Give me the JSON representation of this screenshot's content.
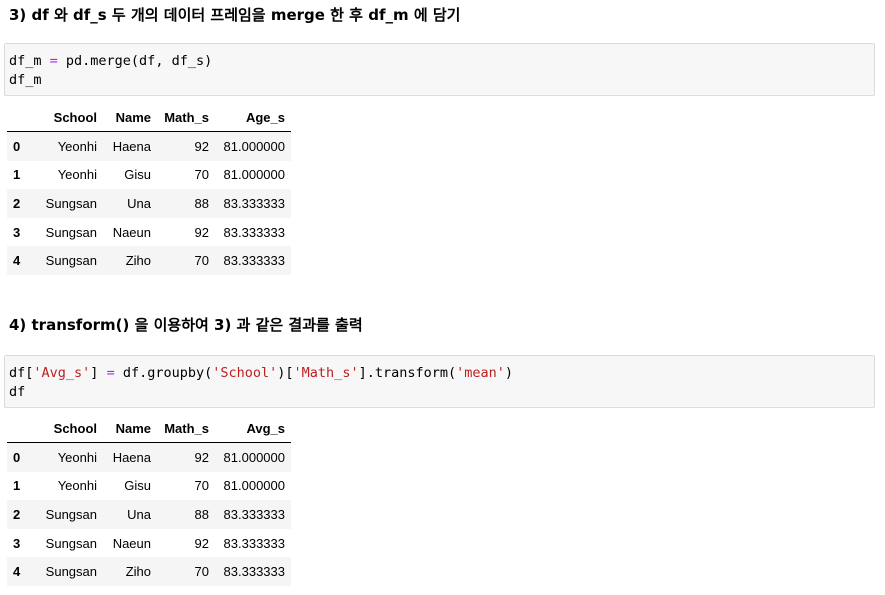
{
  "section1": {
    "heading": "3) df 와 df_s 두 개의 데이터 프레임을 merge 한 후 df_m 에 담기",
    "code": {
      "line1": {
        "a": "df_m ",
        "op": "=",
        "b": " pd.merge(df, df_s)"
      },
      "line2": "df_m"
    },
    "table": {
      "columns": [
        "",
        "School",
        "Name",
        "Math_s",
        "Age_s"
      ],
      "rows": [
        [
          "0",
          "Yeonhi",
          "Haena",
          "92",
          "81.000000"
        ],
        [
          "1",
          "Yeonhi",
          "Gisu",
          "70",
          "81.000000"
        ],
        [
          "2",
          "Sungsan",
          "Una",
          "88",
          "83.333333"
        ],
        [
          "3",
          "Sungsan",
          "Naeun",
          "92",
          "83.333333"
        ],
        [
          "4",
          "Sungsan",
          "Ziho",
          "70",
          "83.333333"
        ]
      ]
    }
  },
  "section2": {
    "heading": "4) transform() 을 이용하여 3) 과 같은 결과를 출력",
    "code": {
      "line1": {
        "p1": "df[",
        "s1": "'Avg_s'",
        "p2": "] ",
        "op": "=",
        "p3": " df.groupby(",
        "s2": "'School'",
        "p4": ")[",
        "s3": "'Math_s'",
        "p5": "].transform(",
        "s4": "'mean'",
        "p6": ")"
      },
      "line2": "df"
    },
    "table": {
      "columns": [
        "",
        "School",
        "Name",
        "Math_s",
        "Avg_s"
      ],
      "rows": [
        [
          "0",
          "Yeonhi",
          "Haena",
          "92",
          "81.000000"
        ],
        [
          "1",
          "Yeonhi",
          "Gisu",
          "70",
          "81.000000"
        ],
        [
          "2",
          "Sungsan",
          "Una",
          "88",
          "83.333333"
        ],
        [
          "3",
          "Sungsan",
          "Naeun",
          "92",
          "83.333333"
        ],
        [
          "4",
          "Sungsan",
          "Ziho",
          "70",
          "83.333333"
        ]
      ]
    }
  }
}
